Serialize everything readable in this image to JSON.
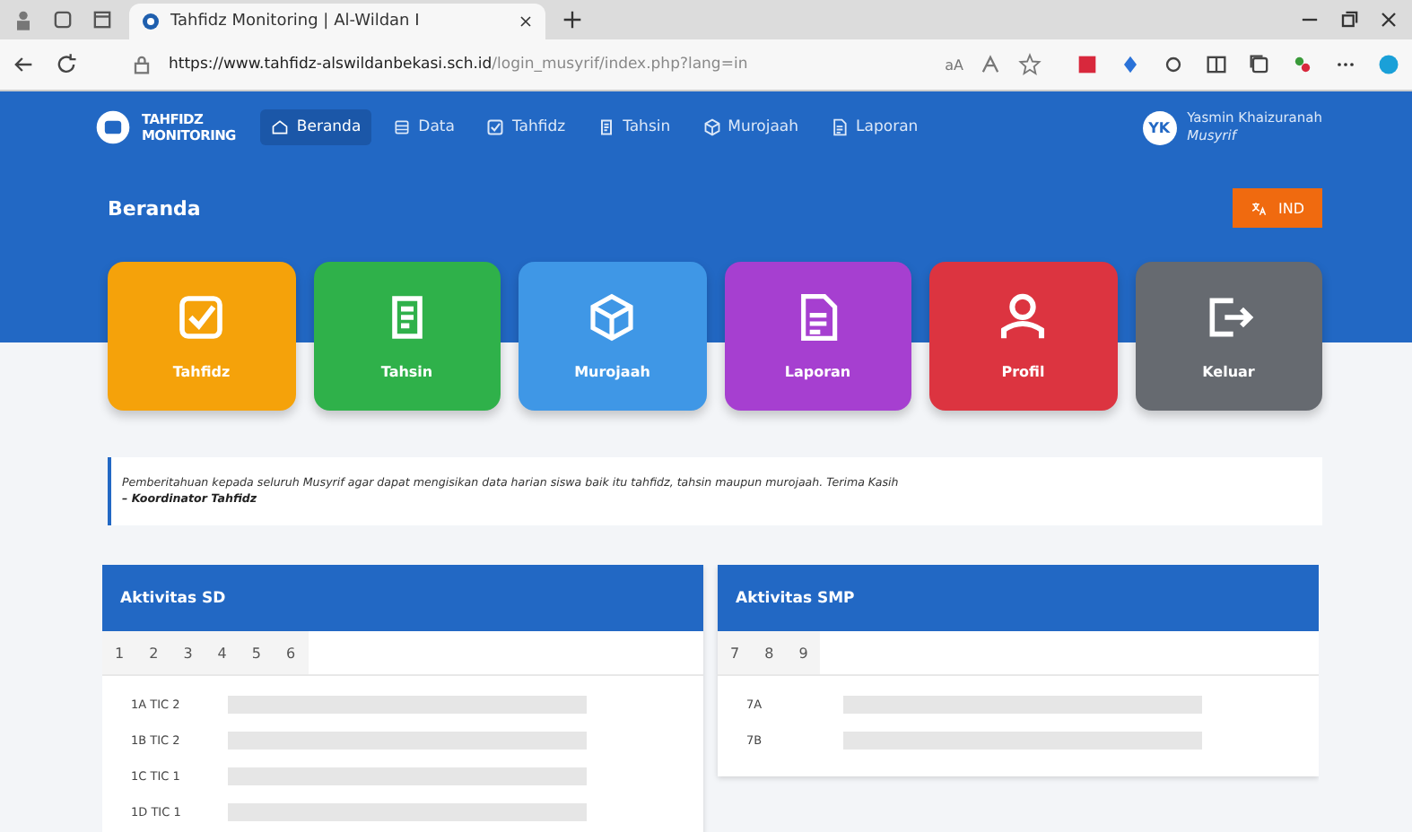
{
  "browser": {
    "tab_title": "Tahfidz Monitoring | Al-Wildan I",
    "url_host": "https://www.tahfidz-alswildanbekasi.sch.id",
    "url_path": "/login_musyrif/index.php?lang=in",
    "reader_label": "aA"
  },
  "header": {
    "logo_line1": "TAHFIDZ",
    "logo_line2": "MONITORING",
    "nav": [
      {
        "label": "Beranda",
        "selected": true
      },
      {
        "label": "Data",
        "selected": false
      },
      {
        "label": "Tahfidz",
        "selected": false
      },
      {
        "label": "Tahsin",
        "selected": false
      },
      {
        "label": "Murojaah",
        "selected": false
      },
      {
        "label": "Laporan",
        "selected": false
      }
    ],
    "user": {
      "initials": "YK",
      "name": "Yasmin Khaizuranah",
      "role": "Musyrif"
    }
  },
  "page_title": "Beranda",
  "language_button": "IND",
  "tiles": [
    {
      "label": "Tahfidz",
      "color": "#f5a20a"
    },
    {
      "label": "Tahsin",
      "color": "#2fb14a"
    },
    {
      "label": "Murojaah",
      "color": "#3f97e6"
    },
    {
      "label": "Laporan",
      "color": "#a63fd0"
    },
    {
      "label": "Profil",
      "color": "#dc3440"
    },
    {
      "label": "Keluar",
      "color": "#666a70"
    }
  ],
  "notice": {
    "text": "Pemberitahuan kepada seluruh Musyrif agar dapat mengisikan data harian siswa baik itu tahfidz, tahsin maupun murojaah. Terima Kasih",
    "signature": "– Koordinator Tahfidz"
  },
  "panels": [
    {
      "title": "Aktivitas SD",
      "tabs": [
        "1",
        "2",
        "3",
        "4",
        "5",
        "6"
      ],
      "rows": [
        "1A TIC 2",
        "1B TIC 2",
        "1C TIC 1",
        "1D TIC 1"
      ]
    },
    {
      "title": "Aktivitas SMP",
      "tabs": [
        "7",
        "8",
        "9"
      ],
      "rows": [
        "7A",
        "7B"
      ]
    }
  ]
}
